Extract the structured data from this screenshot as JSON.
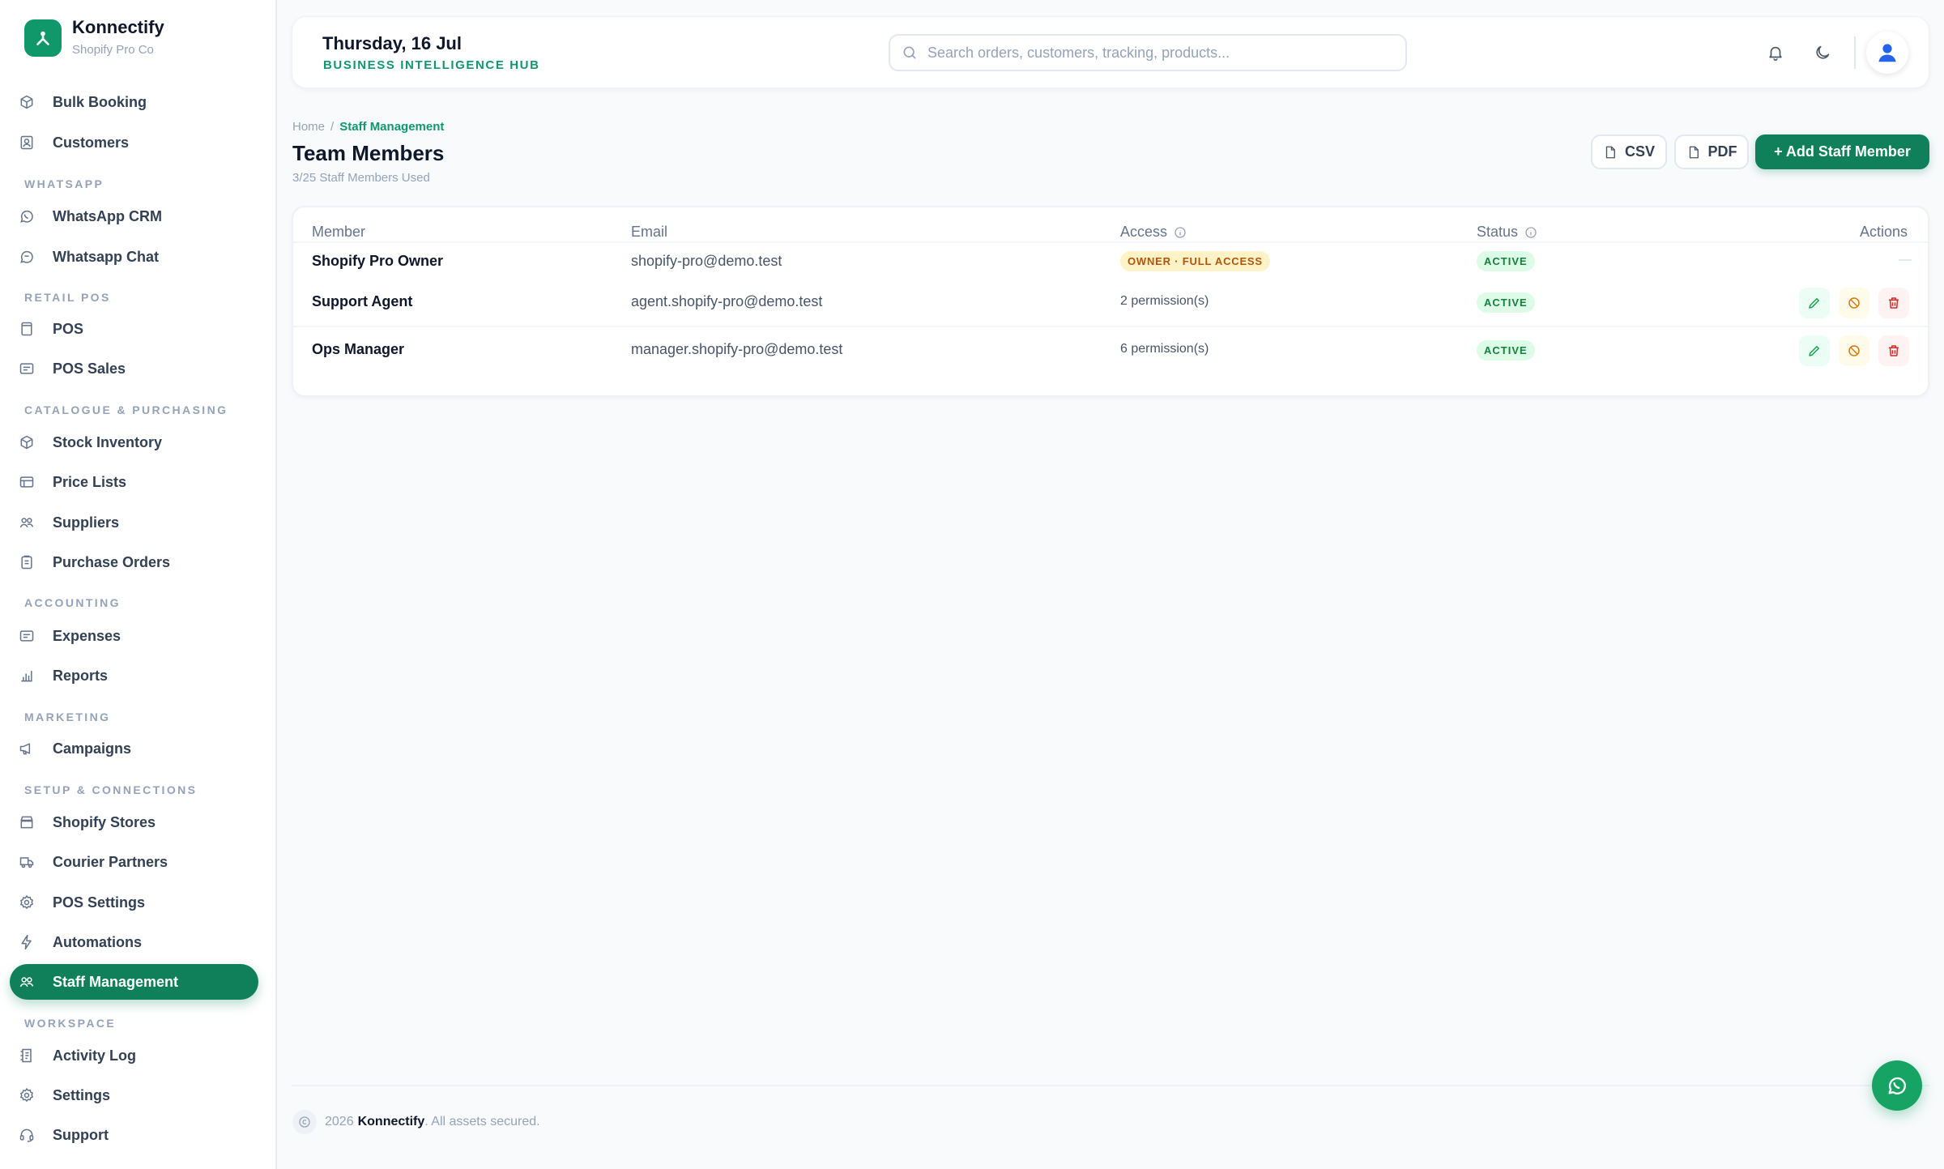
{
  "brand": {
    "name": "Konnectify",
    "company": "Shopify Pro Co"
  },
  "sidebar": {
    "bulk_booking": "Bulk Booking",
    "customers": "Customers",
    "section_whatsapp": "WHATSAPP",
    "whatsapp_crm": "WhatsApp CRM",
    "whatsapp_chat": "Whatsapp Chat",
    "section_retail_pos": "RETAIL POS",
    "pos": "POS",
    "pos_sales": "POS Sales",
    "section_catalogue": "CATALOGUE & PURCHASING",
    "stock_inventory": "Stock Inventory",
    "price_lists": "Price Lists",
    "suppliers": "Suppliers",
    "purchase_orders": "Purchase Orders",
    "section_accounting": "ACCOUNTING",
    "expenses": "Expenses",
    "reports": "Reports",
    "section_marketing": "MARKETING",
    "campaigns": "Campaigns",
    "section_setup": "SETUP & CONNECTIONS",
    "shopify_stores": "Shopify Stores",
    "courier_partners": "Courier Partners",
    "pos_settings": "POS Settings",
    "automations": "Automations",
    "staff_management": "Staff Management",
    "section_workspace": "WORKSPACE",
    "activity_log": "Activity Log",
    "settings": "Settings",
    "support": "Support"
  },
  "header": {
    "date": "Thursday, 16 Jul",
    "subtitle": "BUSINESS INTELLIGENCE HUB",
    "search_placeholder": "Search orders, customers, tracking, products..."
  },
  "breadcrumb": {
    "home": "Home",
    "separator": "/",
    "current": "Staff Management"
  },
  "page": {
    "title": "Team Members",
    "usage": "3/25 Staff Members Used",
    "csv_label": "CSV",
    "pdf_label": "PDF",
    "add_label": "+ Add Staff Member"
  },
  "table": {
    "columns": {
      "member": "Member",
      "email": "Email",
      "access": "Access",
      "status": "Status",
      "actions": "Actions"
    },
    "rows": [
      {
        "member": "Shopify Pro Owner",
        "email": "shopify-pro@demo.test",
        "access": "OWNER · FULL ACCESS",
        "status": "ACTIVE",
        "actions": "—"
      },
      {
        "member": "Support Agent",
        "email": "agent.shopify-pro@demo.test",
        "access": "2 permission(s)",
        "status": "ACTIVE"
      },
      {
        "member": "Ops Manager",
        "email": "manager.shopify-pro@demo.test",
        "access": "6 permission(s)",
        "status": "ACTIVE"
      }
    ]
  },
  "footer": {
    "year": "2026",
    "brand": "Konnectify",
    "text": ". All assets secured."
  },
  "colors": {
    "accent": "#10805b",
    "accent_text": "#10976a",
    "owner_badge": "#fef3c7",
    "active_badge": "#dcfce7",
    "danger": "#dc2626",
    "warning": "#d97706"
  },
  "icons": [
    "box-icon",
    "users-icon",
    "whatsapp-icon",
    "chat-icon",
    "pos-icon",
    "receipt-icon",
    "cube-icon",
    "list-icon",
    "suppliers-icon",
    "clipboard-icon",
    "wallet-icon",
    "bar-chart-icon",
    "megaphone-icon",
    "store-icon",
    "truck-icon",
    "gear-icon",
    "bolt-icon",
    "team-icon",
    "log-icon",
    "headset-icon",
    "search-icon",
    "bell-icon",
    "moon-icon",
    "user-icon",
    "edit-icon",
    "block-icon",
    "trash-icon",
    "info-icon",
    "file-icon",
    "copyright-icon"
  ]
}
